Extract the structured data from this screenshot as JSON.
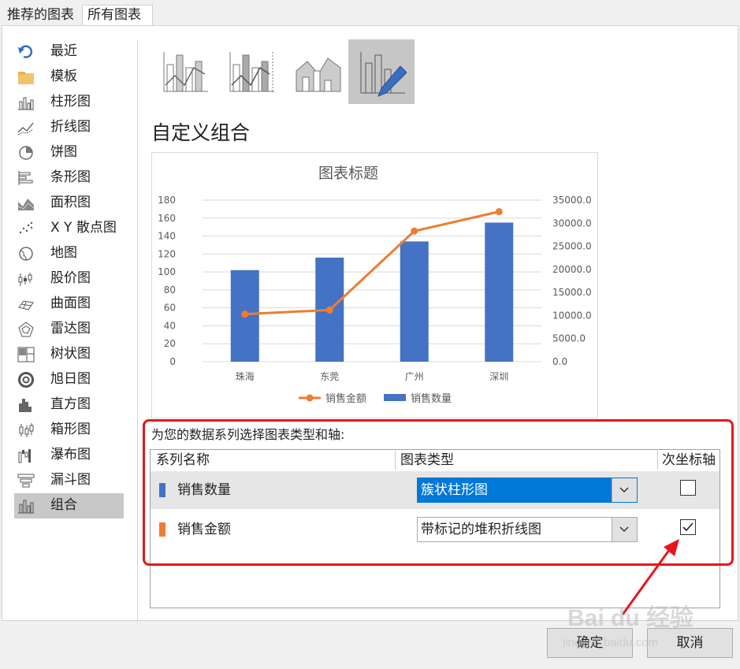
{
  "tabs": [
    {
      "label": "推荐的图表"
    },
    {
      "label": "所有图表"
    }
  ],
  "sidebar": {
    "items": [
      {
        "label": "最近",
        "icon": "recent-icon"
      },
      {
        "label": "模板",
        "icon": "folder-icon"
      },
      {
        "label": "柱形图",
        "icon": "column-chart-icon"
      },
      {
        "label": "折线图",
        "icon": "line-chart-icon"
      },
      {
        "label": "饼图",
        "icon": "pie-chart-icon"
      },
      {
        "label": "条形图",
        "icon": "bar-chart-icon"
      },
      {
        "label": "面积图",
        "icon": "area-chart-icon"
      },
      {
        "label": "X Y 散点图",
        "icon": "scatter-chart-icon"
      },
      {
        "label": "地图",
        "icon": "map-chart-icon"
      },
      {
        "label": "股价图",
        "icon": "stock-chart-icon"
      },
      {
        "label": "曲面图",
        "icon": "surface-chart-icon"
      },
      {
        "label": "雷达图",
        "icon": "radar-chart-icon"
      },
      {
        "label": "树状图",
        "icon": "treemap-chart-icon"
      },
      {
        "label": "旭日图",
        "icon": "sunburst-chart-icon"
      },
      {
        "label": "直方图",
        "icon": "histogram-chart-icon"
      },
      {
        "label": "箱形图",
        "icon": "box-whisker-chart-icon"
      },
      {
        "label": "瀑布图",
        "icon": "waterfall-chart-icon"
      },
      {
        "label": "漏斗图",
        "icon": "funnel-chart-icon"
      },
      {
        "label": "组合",
        "icon": "combo-chart-icon",
        "selected": true
      }
    ]
  },
  "main": {
    "section_title": "自定义组合",
    "series_prompt": "为您的数据系列选择图表类型和轴:",
    "table_headers": {
      "series_name": "系列名称",
      "chart_type": "图表类型",
      "secondary_axis": "次坐标轴"
    },
    "series_rows": [
      {
        "name": "销售数量",
        "chart_type": "簇状柱形图",
        "secondary_axis": false,
        "color": "#4472c4"
      },
      {
        "name": "销售金额",
        "chart_type": "带标记的堆积折线图",
        "secondary_axis": true,
        "color": "#ed7d31"
      }
    ]
  },
  "buttons": {
    "ok": "确定",
    "cancel": "取消"
  },
  "watermark": {
    "text": "Bai du 经验",
    "sub": "jingyan.baidu.com"
  },
  "chart_data": {
    "type": "bar",
    "title": "图表标题",
    "categories": [
      "珠海",
      "东莞",
      "广州",
      "深圳"
    ],
    "series": [
      {
        "name": "销售数量",
        "type": "bar",
        "axis": "primary",
        "color": "#4472c4",
        "values": [
          102,
          116,
          134,
          155
        ]
      },
      {
        "name": "销售金额",
        "type": "line",
        "axis": "secondary",
        "color": "#ed7d31",
        "values": [
          10300,
          11200,
          28300,
          32500
        ]
      }
    ],
    "y_primary": {
      "ylim": [
        0,
        180
      ],
      "ticks": [
        "0",
        "20",
        "40",
        "60",
        "80",
        "100",
        "120",
        "140",
        "160",
        "180"
      ]
    },
    "y_secondary": {
      "ylim": [
        0,
        35000
      ],
      "ticks": [
        "0.0",
        "5000.0",
        "10000.0",
        "15000.0",
        "20000.0",
        "25000.0",
        "30000.0",
        "35000.0"
      ]
    },
    "grid": true,
    "legend": "bottom"
  }
}
